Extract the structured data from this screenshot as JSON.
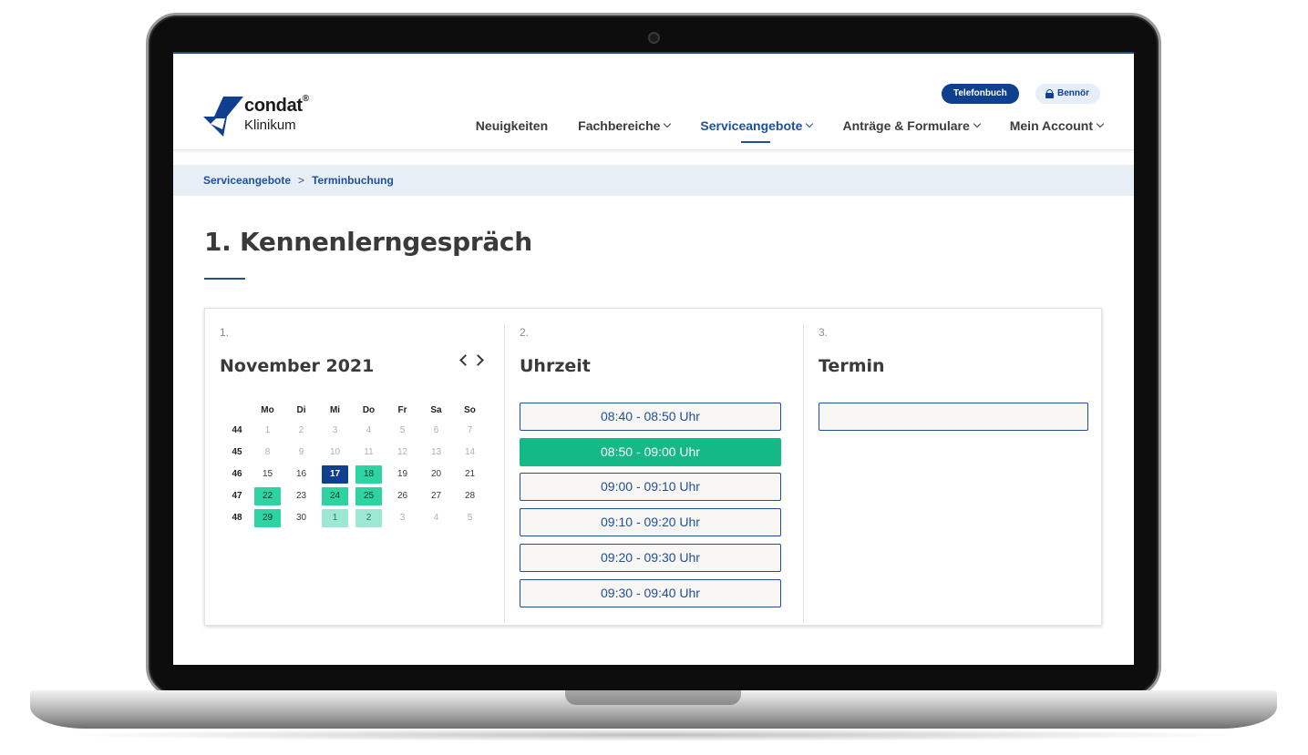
{
  "header": {
    "logo_name": "condat",
    "logo_reg": "®",
    "logo_sub": "Klinikum",
    "phonebook_label": "Telefonbuch",
    "user_label": "Bennör",
    "nav": [
      {
        "label": "Neuigkeiten",
        "has_dropdown": false,
        "active": false
      },
      {
        "label": "Fachbereiche",
        "has_dropdown": true,
        "active": false
      },
      {
        "label": "Serviceangebote",
        "has_dropdown": true,
        "active": true
      },
      {
        "label": "Anträge & Formulare",
        "has_dropdown": true,
        "active": false
      },
      {
        "label": "Mein Account",
        "has_dropdown": true,
        "active": false
      }
    ]
  },
  "breadcrumb": {
    "items": [
      "Serviceangebote",
      "Terminbuchung"
    ],
    "separator": ">"
  },
  "page_title": "1. Kennenlerngespräch",
  "booking": {
    "step1": {
      "number": "1.",
      "title": "November 2021",
      "weekdays": [
        "Mo",
        "Di",
        "Mi",
        "Do",
        "Fr",
        "Sa",
        "So"
      ],
      "weeks": [
        {
          "week": "44",
          "days": [
            {
              "d": "1",
              "s": "muted"
            },
            {
              "d": "2",
              "s": "muted"
            },
            {
              "d": "3",
              "s": "muted"
            },
            {
              "d": "4",
              "s": "muted"
            },
            {
              "d": "5",
              "s": "muted"
            },
            {
              "d": "6",
              "s": "muted"
            },
            {
              "d": "7",
              "s": "muted"
            }
          ]
        },
        {
          "week": "45",
          "days": [
            {
              "d": "8",
              "s": "muted"
            },
            {
              "d": "9",
              "s": "muted"
            },
            {
              "d": "10",
              "s": "muted"
            },
            {
              "d": "11",
              "s": "muted"
            },
            {
              "d": "12",
              "s": "muted"
            },
            {
              "d": "13",
              "s": "muted"
            },
            {
              "d": "14",
              "s": "muted"
            }
          ]
        },
        {
          "week": "46",
          "days": [
            {
              "d": "15",
              "s": ""
            },
            {
              "d": "16",
              "s": ""
            },
            {
              "d": "17",
              "s": "selected"
            },
            {
              "d": "18",
              "s": "avail"
            },
            {
              "d": "19",
              "s": ""
            },
            {
              "d": "20",
              "s": ""
            },
            {
              "d": "21",
              "s": ""
            }
          ]
        },
        {
          "week": "47",
          "days": [
            {
              "d": "22",
              "s": "avail"
            },
            {
              "d": "23",
              "s": ""
            },
            {
              "d": "24",
              "s": "avail"
            },
            {
              "d": "25",
              "s": "avail"
            },
            {
              "d": "26",
              "s": ""
            },
            {
              "d": "27",
              "s": ""
            },
            {
              "d": "28",
              "s": ""
            }
          ]
        },
        {
          "week": "48",
          "days": [
            {
              "d": "29",
              "s": "avail"
            },
            {
              "d": "30",
              "s": ""
            },
            {
              "d": "1",
              "s": "avail-soft"
            },
            {
              "d": "2",
              "s": "avail-soft"
            },
            {
              "d": "3",
              "s": "muted"
            },
            {
              "d": "4",
              "s": "muted"
            },
            {
              "d": "5",
              "s": "muted"
            }
          ]
        }
      ]
    },
    "step2": {
      "number": "2.",
      "title": "Uhrzeit",
      "slots": [
        {
          "label": "08:40 - 08:50 Uhr",
          "active": false
        },
        {
          "label": "08:50 - 09:00 Uhr",
          "active": true
        },
        {
          "label": "09:00 - 09:10 Uhr",
          "active": false
        },
        {
          "label": "09:10 - 09:20 Uhr",
          "active": false
        },
        {
          "label": "09:20 - 09:30 Uhr",
          "active": false
        },
        {
          "label": "09:30 - 09:40 Uhr",
          "active": false
        }
      ]
    },
    "step3": {
      "number": "3.",
      "title": "Termin",
      "value": ""
    }
  },
  "colors": {
    "brand_blue": "#1f4f9a",
    "dark_blue": "#0f3f8f",
    "available_green": "#2ed3a2",
    "active_slot_green": "#15b887"
  }
}
